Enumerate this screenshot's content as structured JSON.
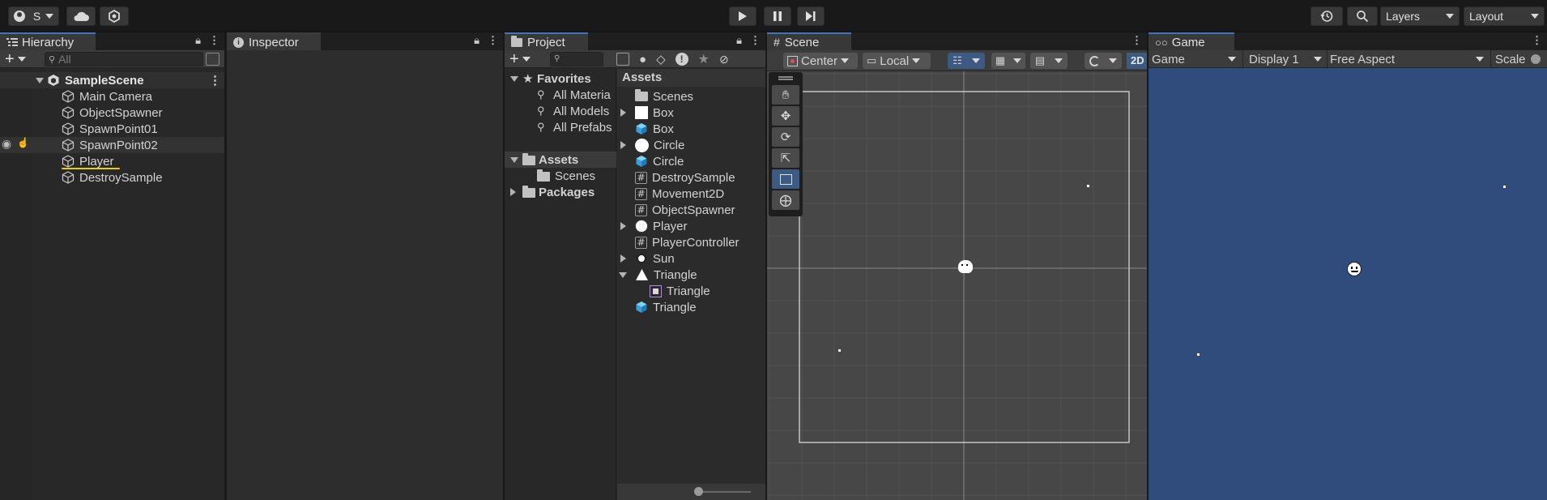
{
  "toolbar": {
    "account_label": "S",
    "play_icon": "play-icon",
    "pause_icon": "pause-icon",
    "step_icon": "step-icon",
    "layers_label": "Layers",
    "layout_label": "Layout"
  },
  "hierarchy": {
    "tab_label": "Hierarchy",
    "search_placeholder": "All",
    "scene_name": "SampleScene",
    "items": [
      {
        "label": "Main Camera"
      },
      {
        "label": "ObjectSpawner"
      },
      {
        "label": "SpawnPoint01"
      },
      {
        "label": "SpawnPoint02"
      },
      {
        "label": "Player"
      },
      {
        "label": "DestroySample"
      }
    ]
  },
  "inspector": {
    "tab_label": "Inspector"
  },
  "project": {
    "tab_label": "Project",
    "favorites_label": "Favorites",
    "favorites": [
      {
        "label": "All Materia"
      },
      {
        "label": "All Models"
      },
      {
        "label": "All Prefabs"
      }
    ],
    "assets_label": "Assets",
    "assets_children": [
      {
        "label": "Scenes"
      }
    ],
    "packages_label": "Packages",
    "assets_header": "Assets",
    "asset_items": [
      {
        "label": "Scenes",
        "icon": "folder-icon"
      },
      {
        "label": "Box",
        "icon": "sprite-icon"
      },
      {
        "label": "Box",
        "icon": "prefab-icon"
      },
      {
        "label": "Circle",
        "icon": "sprite-icon"
      },
      {
        "label": "Circle",
        "icon": "prefab-icon"
      },
      {
        "label": "DestroySample",
        "icon": "script-icon"
      },
      {
        "label": "Movement2D",
        "icon": "script-icon"
      },
      {
        "label": "ObjectSpawner",
        "icon": "script-icon"
      },
      {
        "label": "Player",
        "icon": "sprite-icon"
      },
      {
        "label": "PlayerController",
        "icon": "script-icon"
      },
      {
        "label": "Sun",
        "icon": "sprite-icon"
      },
      {
        "label": "Triangle",
        "icon": "sprite-icon"
      },
      {
        "label": "Triangle",
        "icon": "subsprite-icon"
      },
      {
        "label": "Triangle",
        "icon": "prefab-icon"
      }
    ]
  },
  "scene": {
    "tab_label": "Scene",
    "pivot_label": "Center",
    "space_label": "Local",
    "mode_2d": "2D"
  },
  "game": {
    "tab_label": "Game",
    "view_label": "Game",
    "display_label": "Display 1",
    "aspect_label": "Free Aspect",
    "scale_label": "Scale"
  },
  "colors": {
    "accent": "#3a79bb",
    "game_bg": "#2f4c7c",
    "selection_underline": "#e8d000"
  }
}
